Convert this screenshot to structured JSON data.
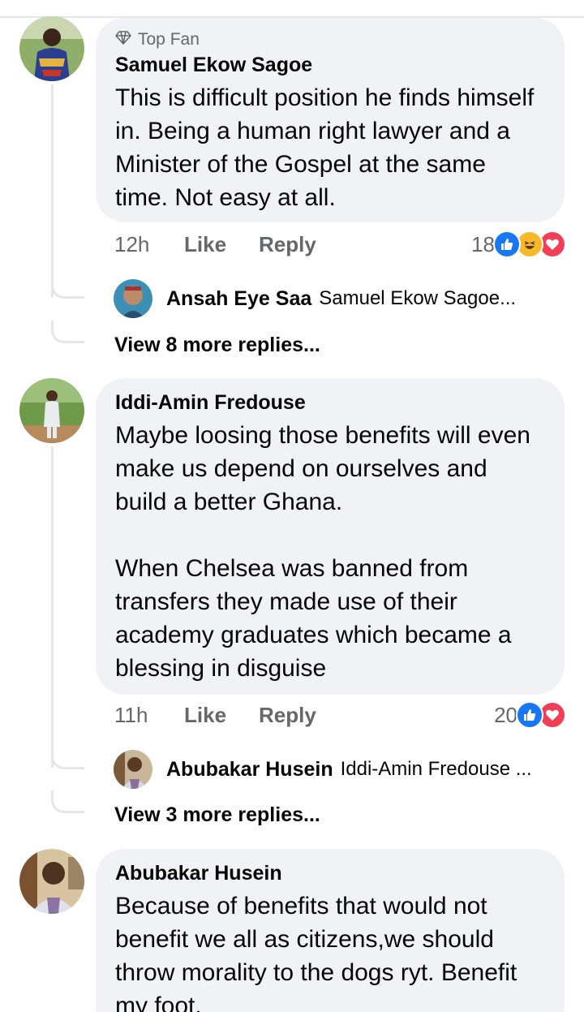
{
  "comments": [
    {
      "badge": "Top Fan",
      "author": "Samuel Ekow Sagoe",
      "text": "This is difficult position he finds himself in. Being a human right lawyer and a Minister of the Gospel at the same time. Not easy at all.",
      "time": "12h",
      "like": "Like",
      "reply": "Reply",
      "reaction_count": "18",
      "reactions": [
        "like-icon",
        "haha-icon",
        "love-icon"
      ],
      "reply_preview": {
        "name": "Ansah Eye Saa",
        "text": "Samuel Ekow Sagoe..."
      },
      "view_more": "View 8 more replies..."
    },
    {
      "author": "Iddi-Amin Fredouse",
      "text": "Maybe loosing those benefits will even make us depend on ourselves and build a better Ghana.\n\nWhen Chelsea was banned from transfers they made use of their academy graduates which became a blessing in disguise",
      "time": "11h",
      "like": "Like",
      "reply": "Reply",
      "reaction_count": "20",
      "reactions": [
        "like-icon",
        "love-icon"
      ],
      "reply_preview": {
        "name": "Abubakar Husein",
        "text": "Iddi-Amin Fredouse ..."
      },
      "view_more": "View 3 more replies..."
    },
    {
      "author": "Abubakar Husein",
      "text": "Because of benefits that would not benefit we all as citizens,we should throw morality to the dogs ryt. Benefit my foot."
    }
  ],
  "colors": {
    "bubble": "#f0f2f5",
    "muted_text": "#65676b",
    "like_blue": "#1877f2",
    "love_red": "#f33e58",
    "haha_yellow": "#f7b928",
    "thread_line": "#e4e6eb"
  }
}
